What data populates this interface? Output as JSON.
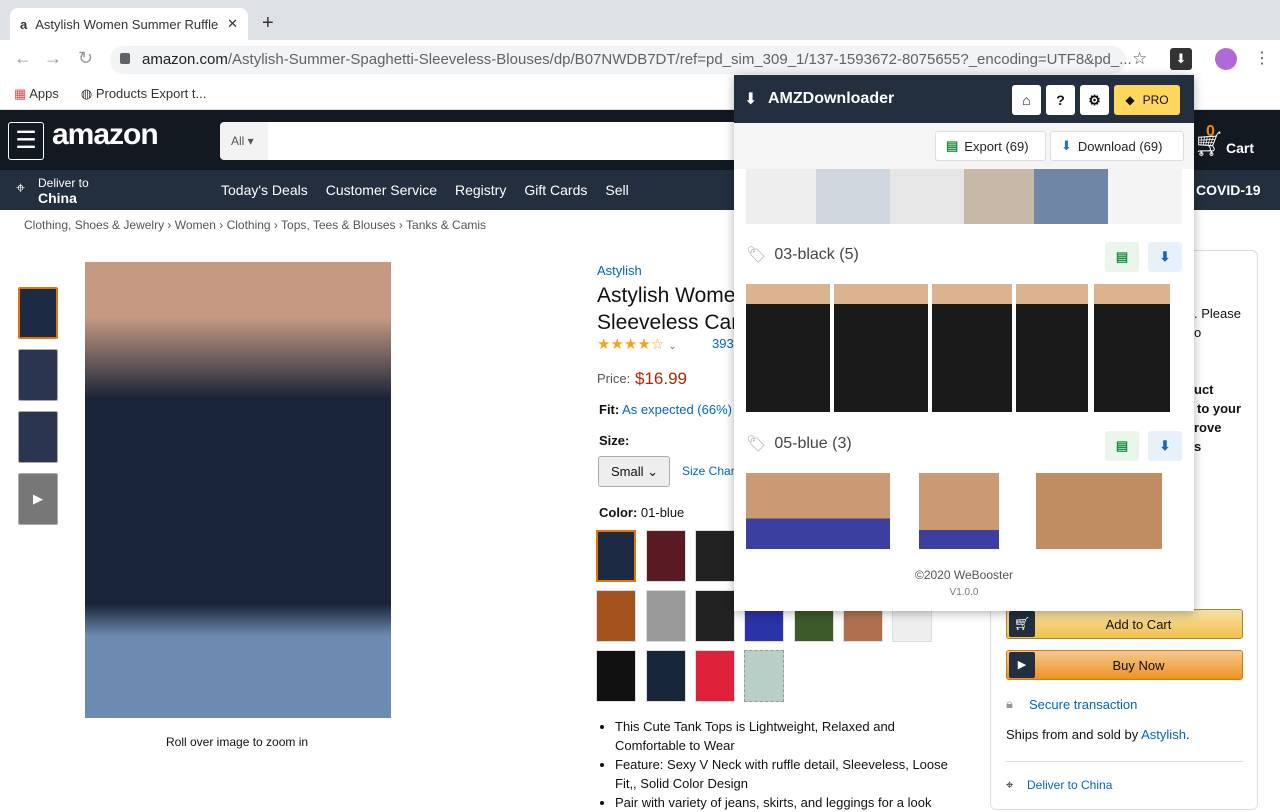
{
  "browser": {
    "tab_title": "Astylish Women Summer Ruffle",
    "url_domain": "amazon.com",
    "url_path": "/Astylish-Summer-Spaghetti-Sleeveless-Blouses/dp/B07NWDB7DT/ref=pd_sim_309_1/137-1593672-8075655?_encoding=UTF8&pd_...",
    "bookmarks": [
      "Apps",
      "Products Export t..."
    ]
  },
  "amazon": {
    "logo": "amazon",
    "search_category": "All",
    "deliver_line1": "Deliver to",
    "deliver_line2": "China",
    "cart_count": "0",
    "cart_label": "Cart",
    "nav": [
      "Today's Deals",
      "Customer Service",
      "Registry",
      "Gift Cards",
      "Sell"
    ],
    "covid": "COVID-19",
    "breadcrumb": [
      "Clothing, Shoes & Jewelry",
      "Women",
      "Clothing",
      "Tops, Tees & Blouses",
      "Tanks & Camis"
    ],
    "zoom_hint": "Roll over image to zoom in",
    "brand": "Astylish",
    "title_l1": "Astylish Wome",
    "title_l2": "Sleeveless Cam",
    "rating_count": "393",
    "rating": 4,
    "price_label": "Price:",
    "price": "$16.99",
    "fit_label": "Fit:",
    "fit_value": "As expected (66%)",
    "size_label": "Size:",
    "size_value": "Small",
    "size_chart": "Size Char",
    "color_label": "Color:",
    "color_value": "01-blue",
    "bullets": [
      "This Cute Tank Tops is Lightweight, Relaxed and Comfortable to Wear",
      "Feature: Sexy V Neck with ruffle detail, Sleeveless, Loose Fit,, Solid Color Design",
      "Pair with variety of jeans, skirts, and leggings for a look"
    ],
    "right_fragments": [
      ". Please",
      "o",
      "uct",
      "to your",
      "rove",
      "s"
    ],
    "add_to_cart": "Add to Cart",
    "buy_now": "Buy Now",
    "secure": "Secure transaction",
    "ships_from": "Ships from and sold by ",
    "seller": "Astylish",
    "ships_end": ".",
    "deliver_to": "Deliver to China"
  },
  "popup": {
    "title": "AMZDownloader",
    "pro": "PRO",
    "export": "Export (69)",
    "download": "Download (69)",
    "sections": [
      {
        "label": "03-black (5)"
      },
      {
        "label": "05-blue (3)"
      }
    ],
    "footer": "©2020 WeBooster",
    "version": "V1.0.0"
  },
  "colors": {
    "amazon_dark": "#131921",
    "amazon_nav": "#232f3e",
    "price": "#b12704",
    "link": "#0066c0",
    "pro": "#ffd75e",
    "add_cart": "#f3cb5c",
    "buy_now": "#f0a54a"
  }
}
